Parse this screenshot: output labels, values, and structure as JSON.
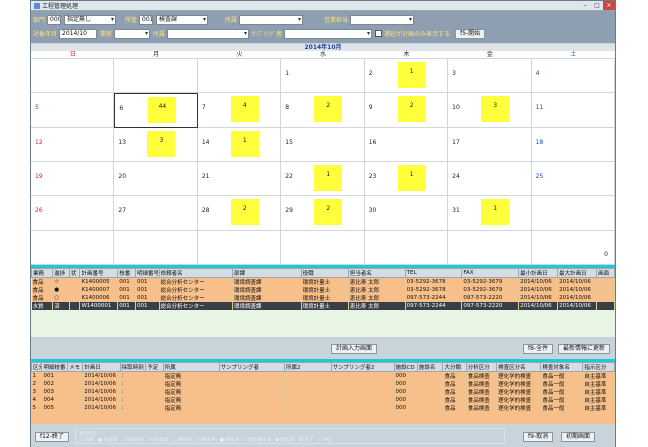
{
  "window": {
    "title": "工程管理処理"
  },
  "filter": {
    "row1": [
      {
        "label": "部門",
        "code": "000",
        "value": "指定無し"
      },
      {
        "label": "所管",
        "code": "001",
        "value": "検査課"
      },
      {
        "label": "所属",
        "value": ""
      },
      {
        "label": "営業担当",
        "value": ""
      }
    ],
    "row2": {
      "month_label": "対象年月",
      "month_value": "2014/10",
      "item_label": "業態",
      "item_value": "",
      "dept_label": "所属",
      "dept_value": "",
      "sampling_label": "ｻﾝﾌﾟﾘﾝｸﾞ者",
      "sampling_value": "",
      "check_label": "遅延が計画のみ表示する",
      "start_button": "f5-開始"
    }
  },
  "calendar": {
    "title": "2014年10月",
    "weekdays": [
      "日",
      "月",
      "火",
      "水",
      "木",
      "金",
      "土"
    ],
    "weeks": [
      [
        {
          "d": ""
        },
        {
          "d": ""
        },
        {
          "d": ""
        },
        {
          "d": "1"
        },
        {
          "d": "2",
          "n": "1"
        },
        {
          "d": "3"
        },
        {
          "d": "4"
        }
      ],
      [
        {
          "d": "5"
        },
        {
          "d": "6",
          "n": "44"
        },
        {
          "d": "7",
          "n": "4"
        },
        {
          "d": "8",
          "n": "2"
        },
        {
          "d": "9",
          "n": "2"
        },
        {
          "d": "10",
          "n": "3"
        },
        {
          "d": "11"
        }
      ],
      [
        {
          "d": "12"
        },
        {
          "d": "13",
          "n": "3"
        },
        {
          "d": "14",
          "n": "1"
        },
        {
          "d": "15"
        },
        {
          "d": "16"
        },
        {
          "d": "17"
        },
        {
          "d": "18"
        }
      ],
      [
        {
          "d": "19"
        },
        {
          "d": "20"
        },
        {
          "d": "21"
        },
        {
          "d": "22",
          "n": "1"
        },
        {
          "d": "23",
          "n": "1"
        },
        {
          "d": "24"
        },
        {
          "d": "25"
        }
      ],
      [
        {
          "d": "26"
        },
        {
          "d": "27"
        },
        {
          "d": "28",
          "n": "2"
        },
        {
          "d": "29",
          "n": "2"
        },
        {
          "d": "30"
        },
        {
          "d": "31",
          "n": "1"
        },
        {
          "d": ""
        }
      ],
      [
        {
          "d": ""
        },
        {
          "d": ""
        },
        {
          "d": ""
        },
        {
          "d": ""
        },
        {
          "d": ""
        },
        {
          "d": ""
        },
        {
          "d": "",
          "z": "0"
        }
      ]
    ]
  },
  "plans": {
    "columns": [
      "業務",
      "進捗",
      "状",
      "計画番号",
      "枝番",
      "明細番号",
      "依頼者名",
      "部課",
      "役職",
      "担当者名",
      "TEL",
      "FAX",
      "最小計画日",
      "最大計画日",
      "画面"
    ],
    "rows": [
      [
        "食品",
        "☆",
        "",
        "K1400005",
        "001",
        "001",
        "総合分析センター",
        "環境調査課",
        "環境計量士",
        "恵比寿 太郎",
        "03-5292-3678",
        "03-5292-3679",
        "2014/10/06",
        "2014/10/06",
        ""
      ],
      [
        "食品",
        "●",
        "",
        "K1400007",
        "001",
        "001",
        "総合分析センター",
        "環境調査課",
        "環境計量士",
        "恵比寿 太郎",
        "03-5292-3678",
        "03-5292-3679",
        "2014/10/06",
        "2014/10/06",
        ""
      ],
      [
        "食品",
        "○",
        "",
        "K1400006",
        "001",
        "001",
        "総合分析センター",
        "環境調査課",
        "環境計量士",
        "恵比寿 太郎",
        "097-573-2244",
        "097-573-2220",
        "2014/10/06",
        "2014/10/06",
        ""
      ],
      [
        "水質",
        "済",
        "",
        "W1400001",
        "001",
        "001",
        "総合分析センター",
        "環境調査課",
        "環境計量士",
        "恵比寿 太郎",
        "097-573-2244",
        "097-573-2220",
        "2014/10/06",
        "2014/10/06",
        ""
      ]
    ]
  },
  "mid_buttons": {
    "plan_input": "計画入力画面",
    "all": "f8-全件",
    "refresh": "最新情報に更新"
  },
  "details": {
    "columns": [
      "区分",
      "明細枝番",
      "メモ",
      "計画日",
      "採取時刻",
      "予定",
      "所属",
      "サンプリング者",
      "所属2",
      "サンプリング者2",
      "施設CD",
      "施設名",
      "大分類",
      "分析区分",
      "検査区分名",
      "検査対象名",
      "指示区分"
    ],
    "rows": [
      [
        "1",
        "001",
        "",
        "2014/10/06",
        ":",
        "",
        "指定無",
        "",
        "",
        "",
        "000",
        "",
        "食品",
        "食品検査",
        "理化学的検査",
        "食品一般",
        "自主基準"
      ],
      [
        "2",
        "002",
        "",
        "2014/10/06",
        ":",
        "",
        "指定無",
        "",
        "",
        "",
        "000",
        "",
        "食品",
        "食品検査",
        "理化学的検査",
        "食品一般",
        "自主基準"
      ],
      [
        "3",
        "003",
        "",
        "2014/10/06",
        ":",
        "",
        "指定無",
        "",
        "",
        "",
        "000",
        "",
        "食品",
        "食品検査",
        "理化学的検査",
        "食品一般",
        "自主基準"
      ],
      [
        "4",
        "004",
        "",
        "2014/10/06",
        ":",
        "",
        "指定無",
        "",
        "",
        "",
        "000",
        "",
        "食品",
        "食品検査",
        "理化学的検査",
        "食品一般",
        "自主基準"
      ],
      [
        "5",
        "005",
        "",
        "2014/10/06",
        ":",
        "",
        "指定無",
        "",
        "",
        "",
        "000",
        "",
        "食品",
        "食品検査",
        "理化学的検査",
        "食品一般",
        "自主基準"
      ]
    ]
  },
  "bottom": {
    "exit_button": "f12-終了",
    "legend_title": "進捗状況",
    "legend_text": "☆:新規　●:計画済　○:採取待ち　◎:採取済　△:受付済　□:検査中　■:検査済　◇:報告書作成　◆:報告済　済:完了　×:中止",
    "cancel_button": "f9-取消",
    "init_button": "初期画面"
  }
}
